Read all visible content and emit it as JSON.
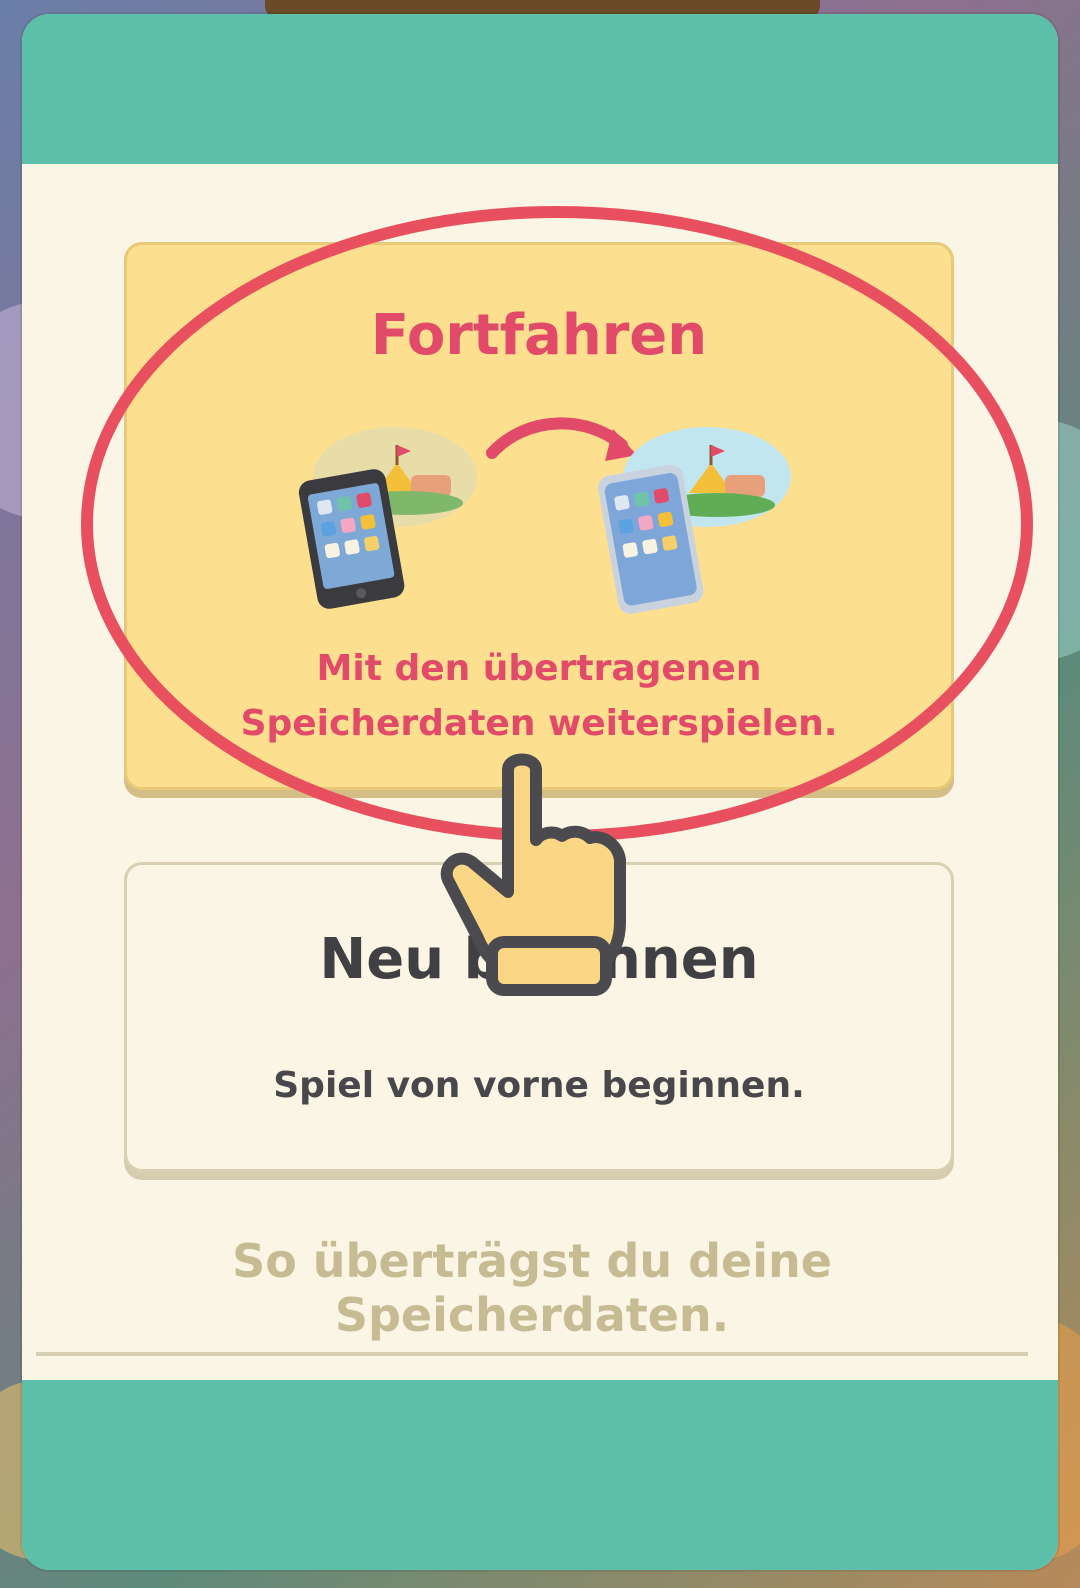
{
  "continue_option": {
    "title": "Fortfahren",
    "description_line1": "Mit den übertragenen",
    "description_line2": "Speicherdaten weiterspielen."
  },
  "new_option": {
    "title": "Neu beginnen",
    "description": "Spiel von vorne beginnen."
  },
  "help_link": {
    "label": "So überträgst du deine Speicherdaten."
  },
  "colors": {
    "header_teal": "#5bbfaa",
    "panel_cream": "#faf5e4",
    "highlight_yellow": "#fcdf8f",
    "accent_red": "#e24a69",
    "ring_red": "#e8505f",
    "link_tan": "#c6bb93"
  },
  "icons": [
    "old-phone-icon",
    "new-phone-icon",
    "camp-island-icon",
    "transfer-arrow-icon",
    "hand-pointer-icon"
  ]
}
